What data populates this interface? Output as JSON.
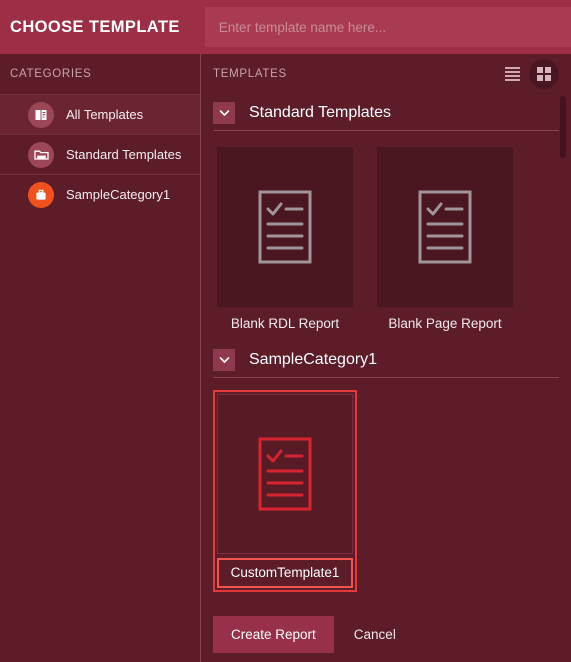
{
  "header": {
    "title": "CHOOSE TEMPLATE",
    "search": {
      "value": "",
      "placeholder": "Enter template name here..."
    }
  },
  "sidebar": {
    "header": "CATEGORIES",
    "items": [
      {
        "label": "All Templates",
        "icon": "report-document-icon",
        "icon_color": "#9c4758",
        "active": true
      },
      {
        "label": "Standard Templates",
        "icon": "folder-icon",
        "icon_color": "#9c4758",
        "active": false
      },
      {
        "label": "SampleCategory1",
        "icon": "briefcase-icon",
        "icon_color": "#f0521f",
        "active": false
      }
    ]
  },
  "templates": {
    "header": "TEMPLATES",
    "view_modes": [
      {
        "name": "list-view",
        "selected": false
      },
      {
        "name": "grid-view",
        "selected": true
      }
    ],
    "sections": [
      {
        "title": "Standard Templates",
        "expanded": true,
        "cards": [
          {
            "label": "Blank RDL Report",
            "icon": "report-document-icon",
            "selected": false
          },
          {
            "label": "Blank Page Report",
            "icon": "report-document-icon",
            "selected": false
          }
        ]
      },
      {
        "title": "SampleCategory1",
        "expanded": true,
        "cards": [
          {
            "label": "CustomTemplate1",
            "icon": "report-document-icon",
            "selected": true
          }
        ]
      }
    ]
  },
  "footer": {
    "create_label": "Create Report",
    "cancel_label": "Cancel"
  },
  "colors": {
    "header_bg": "#9c2f45",
    "panel_bg": "#5c1d29",
    "card_bg": "#4a1720",
    "accent_orange": "#f0521f",
    "selection_red": "#e23a3a",
    "primary_button": "#98304a"
  }
}
